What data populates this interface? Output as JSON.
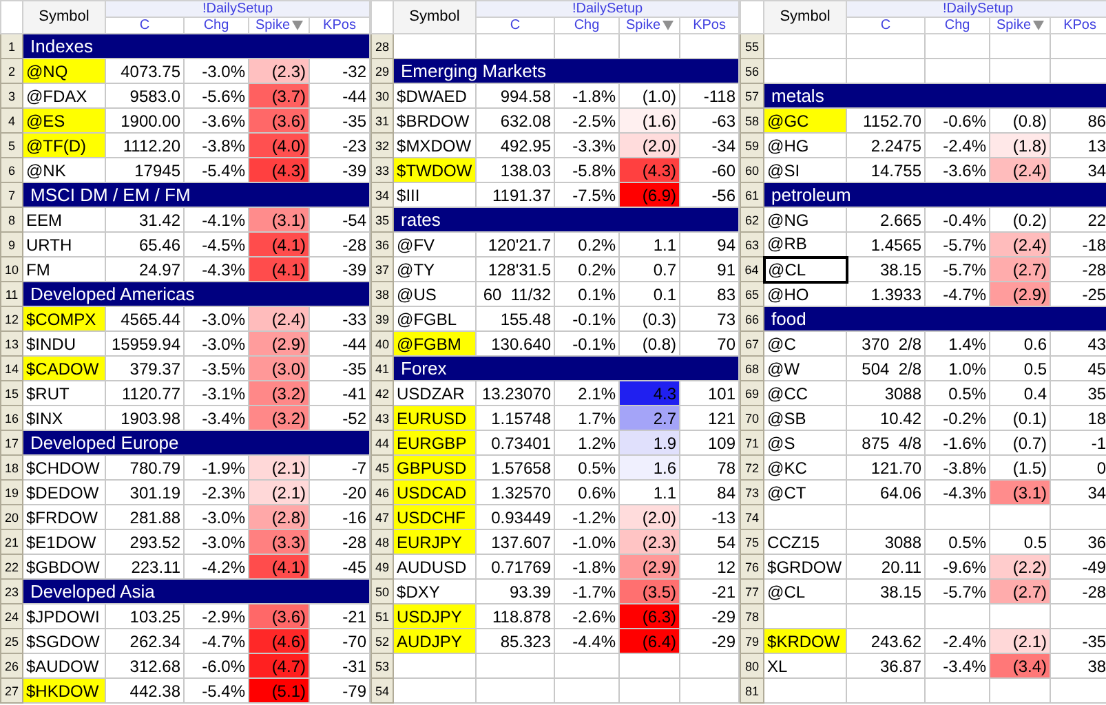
{
  "panels": [
    {
      "header": {
        "symbol": "Symbol",
        "group": "!DailySetup",
        "columns": [
          {
            "label": "C",
            "sorted": false
          },
          {
            "label": "Chg",
            "sorted": false
          },
          {
            "label": "Spike",
            "sorted": true
          },
          {
            "label": "KPos",
            "sorted": false
          }
        ]
      },
      "rows": [
        {
          "number": "1",
          "kind": "section",
          "label": "Indexes"
        },
        {
          "number": "2",
          "kind": "data",
          "symbol": "@NQ",
          "highlighted": true,
          "selected": false,
          "c": "4073.75",
          "chg": "-3.0%",
          "spike": "(2.3)",
          "kpos": "-32",
          "color": "#ffc0c0"
        },
        {
          "number": "3",
          "kind": "data",
          "symbol": "@FDAX",
          "highlighted": false,
          "selected": false,
          "c": "9583.0",
          "chg": "-5.6%",
          "spike": "(3.7)",
          "kpos": "-44",
          "color": "#ff6060"
        },
        {
          "number": "4",
          "kind": "data",
          "symbol": "@ES",
          "highlighted": true,
          "selected": false,
          "c": "1900.00",
          "chg": "-3.6%",
          "spike": "(3.6)",
          "kpos": "-35",
          "color": "#ff6868"
        },
        {
          "number": "5",
          "kind": "data",
          "symbol": "@TF(D)",
          "highlighted": true,
          "selected": false,
          "c": "1112.20",
          "chg": "-3.8%",
          "spike": "(4.0)",
          "kpos": "-23",
          "color": "#ff5050"
        },
        {
          "number": "6",
          "kind": "data",
          "symbol": "@NK",
          "highlighted": false,
          "selected": false,
          "c": "17945",
          "chg": "-5.4%",
          "spike": "(4.3)",
          "kpos": "-39",
          "color": "#ff4040"
        },
        {
          "number": "7",
          "kind": "section",
          "label": "MSCI DM / EM / FM"
        },
        {
          "number": "8",
          "kind": "data",
          "symbol": "EEM",
          "highlighted": false,
          "selected": false,
          "c": "31.42",
          "chg": "-4.1%",
          "spike": "(3.1)",
          "kpos": "-54",
          "color": "#ff8c8c"
        },
        {
          "number": "9",
          "kind": "data",
          "symbol": "URTH",
          "highlighted": false,
          "selected": false,
          "c": "65.46",
          "chg": "-4.5%",
          "spike": "(4.1)",
          "kpos": "-28",
          "color": "#ff4c4c"
        },
        {
          "number": "10",
          "kind": "data",
          "symbol": "FM",
          "highlighted": false,
          "selected": false,
          "c": "24.97",
          "chg": "-4.3%",
          "spike": "(4.1)",
          "kpos": "-39",
          "color": "#ff4c4c"
        },
        {
          "number": "11",
          "kind": "section",
          "label": "Developed Americas"
        },
        {
          "number": "12",
          "kind": "data",
          "symbol": "$COMPX",
          "highlighted": true,
          "selected": false,
          "c": "4565.44",
          "chg": "-3.0%",
          "spike": "(2.4)",
          "kpos": "-33",
          "color": "#ffbcbc"
        },
        {
          "number": "13",
          "kind": "data",
          "symbol": "$INDU",
          "highlighted": false,
          "selected": false,
          "c": "15959.94",
          "chg": "-3.0%",
          "spike": "(2.9)",
          "kpos": "-44",
          "color": "#ff9c9c"
        },
        {
          "number": "14",
          "kind": "data",
          "symbol": "$CADOW",
          "highlighted": true,
          "selected": false,
          "c": "379.37",
          "chg": "-3.5%",
          "spike": "(3.0)",
          "kpos": "-35",
          "color": "#ff9898"
        },
        {
          "number": "15",
          "kind": "data",
          "symbol": "$RUT",
          "highlighted": false,
          "selected": false,
          "c": "1120.77",
          "chg": "-3.1%",
          "spike": "(3.2)",
          "kpos": "-41",
          "color": "#ff8888"
        },
        {
          "number": "16",
          "kind": "data",
          "symbol": "$INX",
          "highlighted": false,
          "selected": false,
          "c": "1903.98",
          "chg": "-3.4%",
          "spike": "(3.2)",
          "kpos": "-52",
          "color": "#ff8888"
        },
        {
          "number": "17",
          "kind": "section",
          "label": "Developed Europe"
        },
        {
          "number": "18",
          "kind": "data",
          "symbol": "$CHDOW",
          "highlighted": false,
          "selected": false,
          "c": "780.79",
          "chg": "-1.9%",
          "spike": "(2.1)",
          "kpos": "-7",
          "color": "#ffd8d8"
        },
        {
          "number": "19",
          "kind": "data",
          "symbol": "$DEDOW",
          "highlighted": false,
          "selected": false,
          "c": "301.19",
          "chg": "-2.3%",
          "spike": "(2.1)",
          "kpos": "-20",
          "color": "#ffd8d8"
        },
        {
          "number": "20",
          "kind": "data",
          "symbol": "$FRDOW",
          "highlighted": false,
          "selected": false,
          "c": "281.88",
          "chg": "-3.0%",
          "spike": "(2.8)",
          "kpos": "-16",
          "color": "#ffa8a8"
        },
        {
          "number": "21",
          "kind": "data",
          "symbol": "$E1DOW",
          "highlighted": false,
          "selected": false,
          "c": "293.52",
          "chg": "-3.0%",
          "spike": "(3.3)",
          "kpos": "-28",
          "color": "#ff8080"
        },
        {
          "number": "22",
          "kind": "data",
          "symbol": "$GBDOW",
          "highlighted": false,
          "selected": false,
          "c": "223.11",
          "chg": "-4.2%",
          "spike": "(4.1)",
          "kpos": "-45",
          "color": "#ff4c4c"
        },
        {
          "number": "23",
          "kind": "section",
          "label": "Developed Asia"
        },
        {
          "number": "24",
          "kind": "data",
          "symbol": "$JPDOWI",
          "highlighted": false,
          "selected": false,
          "c": "103.25",
          "chg": "-2.9%",
          "spike": "(3.6)",
          "kpos": "-21",
          "color": "#ff6868"
        },
        {
          "number": "25",
          "kind": "data",
          "symbol": "$SGDOW",
          "highlighted": false,
          "selected": false,
          "c": "262.34",
          "chg": "-4.7%",
          "spike": "(4.6)",
          "kpos": "-70",
          "color": "#ff2828"
        },
        {
          "number": "26",
          "kind": "data",
          "symbol": "$AUDOW",
          "highlighted": false,
          "selected": false,
          "c": "312.68",
          "chg": "-6.0%",
          "spike": "(4.7)",
          "kpos": "-31",
          "color": "#ff2020"
        },
        {
          "number": "27",
          "kind": "data",
          "symbol": "$HKDOW",
          "highlighted": true,
          "selected": false,
          "c": "442.38",
          "chg": "-5.4%",
          "spike": "(5.1)",
          "kpos": "-79",
          "color": "#ff0000"
        }
      ]
    },
    {
      "header": {
        "symbol": "Symbol",
        "group": "!DailySetup",
        "columns": [
          {
            "label": "C",
            "sorted": false
          },
          {
            "label": "Chg",
            "sorted": false
          },
          {
            "label": "Spike",
            "sorted": true
          },
          {
            "label": "KPos",
            "sorted": false
          }
        ]
      },
      "rows": [
        {
          "number": "28",
          "kind": "empty"
        },
        {
          "number": "29",
          "kind": "section",
          "label": "Emerging Markets"
        },
        {
          "number": "30",
          "kind": "data",
          "symbol": "$DWAED",
          "highlighted": false,
          "selected": false,
          "c": "994.58",
          "chg": "-1.8%",
          "spike": "(1.0)",
          "kpos": "-118"
        },
        {
          "number": "31",
          "kind": "data",
          "symbol": "$BRDOW",
          "highlighted": false,
          "selected": false,
          "c": "632.08",
          "chg": "-2.5%",
          "spike": "(1.6)",
          "kpos": "-63",
          "color": "#fff0f0"
        },
        {
          "number": "32",
          "kind": "data",
          "symbol": "$MXDOW",
          "highlighted": false,
          "selected": false,
          "c": "492.95",
          "chg": "-3.3%",
          "spike": "(2.0)",
          "kpos": "-34",
          "color": "#ffdcdc"
        },
        {
          "number": "33",
          "kind": "data",
          "symbol": "$TWDOW",
          "highlighted": true,
          "selected": false,
          "c": "138.03",
          "chg": "-5.8%",
          "spike": "(4.3)",
          "kpos": "-60",
          "color": "#ff4040"
        },
        {
          "number": "34",
          "kind": "data",
          "symbol": "$III",
          "highlighted": false,
          "selected": false,
          "c": "1191.37",
          "chg": "-7.5%",
          "spike": "(6.9)",
          "kpos": "-56",
          "color": "#ff0000"
        },
        {
          "number": "35",
          "kind": "section",
          "label": "rates"
        },
        {
          "number": "36",
          "kind": "data",
          "symbol": "@FV",
          "highlighted": false,
          "selected": false,
          "c": "120'21.7",
          "chg": "0.2%",
          "spike": "1.1",
          "kpos": "94"
        },
        {
          "number": "37",
          "kind": "data",
          "symbol": "@TY",
          "highlighted": false,
          "selected": false,
          "c": "128'31.5",
          "chg": "0.2%",
          "spike": "0.7",
          "kpos": "91"
        },
        {
          "number": "38",
          "kind": "data",
          "symbol": "@US",
          "highlighted": false,
          "selected": false,
          "c": "60  11/32",
          "chg": "0.1%",
          "spike": "0.1",
          "kpos": "83"
        },
        {
          "number": "39",
          "kind": "data",
          "symbol": "@FGBL",
          "highlighted": false,
          "selected": false,
          "c": "155.48",
          "chg": "-0.1%",
          "spike": "(0.3)",
          "kpos": "73"
        },
        {
          "number": "40",
          "kind": "data",
          "symbol": "@FGBM",
          "highlighted": true,
          "selected": false,
          "c": "130.640",
          "chg": "-0.1%",
          "spike": "(0.8)",
          "kpos": "70"
        },
        {
          "number": "41",
          "kind": "section",
          "label": "Forex"
        },
        {
          "number": "42",
          "kind": "data",
          "symbol": "USDZAR",
          "highlighted": false,
          "selected": false,
          "c": "13.23070",
          "chg": "2.1%",
          "spike": "4.3",
          "kpos": "101",
          "color": "#2020f0"
        },
        {
          "number": "43",
          "kind": "data",
          "symbol": "EURUSD",
          "highlighted": true,
          "selected": false,
          "c": "1.15748",
          "chg": "1.7%",
          "spike": "2.7",
          "kpos": "121",
          "color": "#a4a4f8"
        },
        {
          "number": "44",
          "kind": "data",
          "symbol": "EURGBP",
          "highlighted": true,
          "selected": false,
          "c": "0.73401",
          "chg": "1.2%",
          "spike": "1.9",
          "kpos": "109",
          "color": "#e0e0fc"
        },
        {
          "number": "45",
          "kind": "data",
          "symbol": "GBPUSD",
          "highlighted": true,
          "selected": false,
          "c": "1.57658",
          "chg": "0.5%",
          "spike": "1.6",
          "kpos": "78",
          "color": "#f0f0fe"
        },
        {
          "number": "46",
          "kind": "data",
          "symbol": "USDCAD",
          "highlighted": true,
          "selected": false,
          "c": "1.32570",
          "chg": "0.6%",
          "spike": "1.1",
          "kpos": "84"
        },
        {
          "number": "47",
          "kind": "data",
          "symbol": "USDCHF",
          "highlighted": true,
          "selected": false,
          "c": "0.93449",
          "chg": "-1.2%",
          "spike": "(2.0)",
          "kpos": "-13",
          "color": "#ffdcdc"
        },
        {
          "number": "48",
          "kind": "data",
          "symbol": "EURJPY",
          "highlighted": true,
          "selected": false,
          "c": "137.607",
          "chg": "-1.0%",
          "spike": "(2.3)",
          "kpos": "54",
          "color": "#ffc4c4"
        },
        {
          "number": "49",
          "kind": "data",
          "symbol": "AUDUSD",
          "highlighted": false,
          "selected": false,
          "c": "0.71769",
          "chg": "-1.8%",
          "spike": "(2.9)",
          "kpos": "12",
          "color": "#ff9898"
        },
        {
          "number": "50",
          "kind": "data",
          "symbol": "$DXY",
          "highlighted": false,
          "selected": false,
          "c": "93.39",
          "chg": "-1.7%",
          "spike": "(3.5)",
          "kpos": "-21",
          "color": "#ff7070"
        },
        {
          "number": "51",
          "kind": "data",
          "symbol": "USDJPY",
          "highlighted": true,
          "selected": false,
          "c": "118.878",
          "chg": "-2.6%",
          "spike": "(6.3)",
          "kpos": "-29",
          "color": "#ff0000"
        },
        {
          "number": "52",
          "kind": "data",
          "symbol": "AUDJPY",
          "highlighted": true,
          "selected": false,
          "c": "85.323",
          "chg": "-4.4%",
          "spike": "(6.4)",
          "kpos": "-29",
          "color": "#ff0000"
        },
        {
          "number": "53",
          "kind": "empty"
        },
        {
          "number": "54",
          "kind": "empty"
        }
      ]
    },
    {
      "header": {
        "symbol": "Symbol",
        "group": "!DailySetup",
        "columns": [
          {
            "label": "C",
            "sorted": false
          },
          {
            "label": "Chg",
            "sorted": false
          },
          {
            "label": "Spike",
            "sorted": true
          },
          {
            "label": "KPos",
            "sorted": false
          }
        ]
      },
      "rows": [
        {
          "number": "55",
          "kind": "empty"
        },
        {
          "number": "56",
          "kind": "empty"
        },
        {
          "number": "57",
          "kind": "section",
          "label": "metals"
        },
        {
          "number": "58",
          "kind": "data",
          "symbol": "@GC",
          "highlighted": true,
          "selected": false,
          "c": "1152.70",
          "chg": "-0.6%",
          "spike": "(0.8)",
          "kpos": "86"
        },
        {
          "number": "59",
          "kind": "data",
          "symbol": "@HG",
          "highlighted": false,
          "selected": false,
          "c": "2.2475",
          "chg": "-2.4%",
          "spike": "(1.8)",
          "kpos": "13",
          "color": "#ffe8e8"
        },
        {
          "number": "60",
          "kind": "data",
          "symbol": "@SI",
          "highlighted": false,
          "selected": false,
          "c": "14.755",
          "chg": "-3.6%",
          "spike": "(2.4)",
          "kpos": "34",
          "color": "#ffbcbc"
        },
        {
          "number": "61",
          "kind": "section",
          "label": "petroleum"
        },
        {
          "number": "62",
          "kind": "data",
          "symbol": "@NG",
          "highlighted": false,
          "selected": false,
          "c": "2.665",
          "chg": "-0.4%",
          "spike": "(0.2)",
          "kpos": "22"
        },
        {
          "number": "63",
          "kind": "data",
          "symbol": "@RB",
          "highlighted": false,
          "selected": false,
          "c": "1.4565",
          "chg": "-5.7%",
          "spike": "(2.4)",
          "kpos": "-18",
          "color": "#ffbcbc"
        },
        {
          "number": "64",
          "kind": "data",
          "symbol": "@CL",
          "highlighted": false,
          "selected": true,
          "c": "38.15",
          "chg": "-5.7%",
          "spike": "(2.7)",
          "kpos": "-28",
          "color": "#ffacac"
        },
        {
          "number": "65",
          "kind": "data",
          "symbol": "@HO",
          "highlighted": false,
          "selected": false,
          "c": "1.3933",
          "chg": "-4.7%",
          "spike": "(2.9)",
          "kpos": "-25",
          "color": "#ff9c9c"
        },
        {
          "number": "66",
          "kind": "section",
          "label": "food"
        },
        {
          "number": "67",
          "kind": "data",
          "symbol": "@C",
          "highlighted": false,
          "selected": false,
          "c": "370  2/8",
          "chg": "1.4%",
          "spike": "0.6",
          "kpos": "43"
        },
        {
          "number": "68",
          "kind": "data",
          "symbol": "@W",
          "highlighted": false,
          "selected": false,
          "c": "504  2/8",
          "chg": "1.0%",
          "spike": "0.5",
          "kpos": "45"
        },
        {
          "number": "69",
          "kind": "data",
          "symbol": "@CC",
          "highlighted": false,
          "selected": false,
          "c": "3088",
          "chg": "0.5%",
          "spike": "0.4",
          "kpos": "35"
        },
        {
          "number": "70",
          "kind": "data",
          "symbol": "@SB",
          "highlighted": false,
          "selected": false,
          "c": "10.42",
          "chg": "-0.2%",
          "spike": "(0.1)",
          "kpos": "18"
        },
        {
          "number": "71",
          "kind": "data",
          "symbol": "@S",
          "highlighted": false,
          "selected": false,
          "c": "875  4/8",
          "chg": "-1.6%",
          "spike": "(0.7)",
          "kpos": "-1"
        },
        {
          "number": "72",
          "kind": "data",
          "symbol": "@KC",
          "highlighted": false,
          "selected": false,
          "c": "121.70",
          "chg": "-3.8%",
          "spike": "(1.5)",
          "kpos": "0"
        },
        {
          "number": "73",
          "kind": "data",
          "symbol": "@CT",
          "highlighted": false,
          "selected": false,
          "c": "64.06",
          "chg": "-4.3%",
          "spike": "(3.1)",
          "kpos": "34",
          "color": "#ff8c8c"
        },
        {
          "number": "74",
          "kind": "empty"
        },
        {
          "number": "75",
          "kind": "data",
          "symbol": "CCZ15",
          "highlighted": false,
          "selected": false,
          "c": "3088",
          "chg": "0.5%",
          "spike": "0.5",
          "kpos": "36"
        },
        {
          "number": "76",
          "kind": "data",
          "symbol": "$GRDOW",
          "highlighted": false,
          "selected": false,
          "c": "20.11",
          "chg": "-9.6%",
          "spike": "(2.2)",
          "kpos": "-49",
          "color": "#ffcccc"
        },
        {
          "number": "77",
          "kind": "data",
          "symbol": "@CL",
          "highlighted": false,
          "selected": false,
          "c": "38.15",
          "chg": "-5.7%",
          "spike": "(2.7)",
          "kpos": "-28",
          "color": "#ffacac"
        },
        {
          "number": "78",
          "kind": "empty"
        },
        {
          "number": "79",
          "kind": "data",
          "symbol": "$KRDOW",
          "highlighted": true,
          "selected": false,
          "c": "243.62",
          "chg": "-2.4%",
          "spike": "(2.1)",
          "kpos": "-35",
          "color": "#ffd8d8"
        },
        {
          "number": "80",
          "kind": "data",
          "symbol": "XL",
          "highlighted": false,
          "selected": false,
          "c": "36.87",
          "chg": "-3.4%",
          "spike": "(3.4)",
          "kpos": "38",
          "color": "#ff7878"
        },
        {
          "number": "81",
          "kind": "empty"
        }
      ]
    }
  ]
}
